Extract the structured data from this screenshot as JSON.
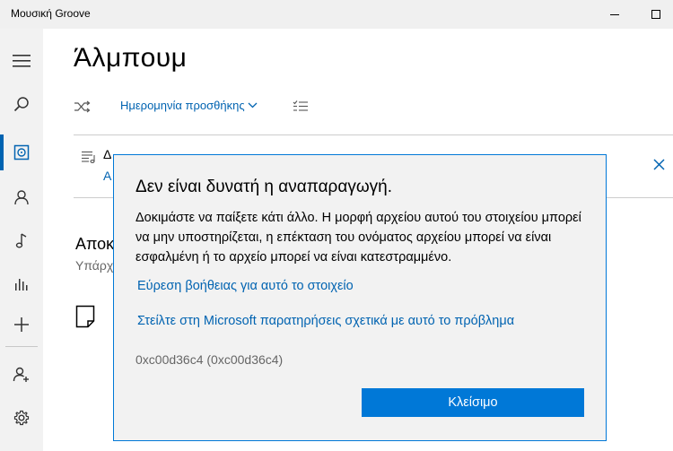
{
  "window": {
    "title": "Μουσική Groove"
  },
  "sidebar": {
    "items": [
      {
        "icon": "hamburger-icon"
      },
      {
        "icon": "search-icon"
      },
      {
        "icon": "my-music-icon",
        "active": true
      },
      {
        "icon": "artist-icon"
      },
      {
        "icon": "music-note-icon"
      },
      {
        "icon": "now-playing-icon"
      },
      {
        "icon": "plus-icon"
      },
      {
        "icon": "add-user-icon"
      },
      {
        "icon": "gear-icon"
      }
    ]
  },
  "page": {
    "title": "Άλμπουμ"
  },
  "toolbar": {
    "sort_label": "Ημερομηνία προσθήκης"
  },
  "banner": {
    "line1": "Δ",
    "line2": "Α"
  },
  "section": {
    "title": "Αποκ",
    "subtitle": "Υπάρχ"
  },
  "dialog": {
    "title": "Δεν είναι δυνατή η αναπαραγωγή.",
    "message": "Δοκιμάστε να παίξετε κάτι άλλο. Η μορφή αρχείου αυτού του στοιχείου μπορεί να μην υποστηρίζεται, η επέκταση του ονόματος αρχείου μπορεί να είναι εσφαλμένη ή το αρχείο μπορεί να είναι κατεστραμμένο.",
    "help_link": "Εύρεση βοήθειας για αυτό το στοιχείο",
    "feedback_link": "Στείλτε στη Microsoft παρατηρήσεις σχετικά με αυτό το πρόβλημα",
    "error_code": "0xc00d36c4 (0xc00d36c4)",
    "close_label": "Κλείσιμο"
  },
  "colors": {
    "accent": "#0078d7",
    "link": "#0063b1",
    "dialog_bg": "#f2f2f2"
  }
}
